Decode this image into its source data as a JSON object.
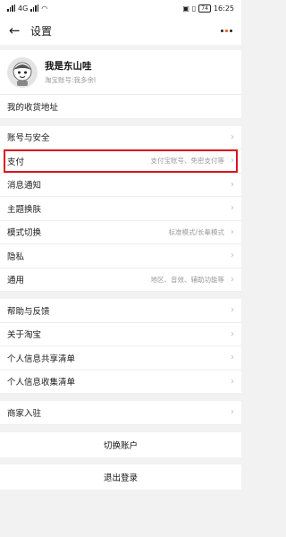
{
  "status_bar": {
    "signal": "4G",
    "time": "16:25",
    "battery": "74"
  },
  "header": {
    "title": "设置"
  },
  "profile": {
    "nickname": "我是东山哇",
    "account": "淘宝账号:我多余l"
  },
  "rows": {
    "address": {
      "label": "我的收货地址"
    },
    "account_security": {
      "label": "账号与安全"
    },
    "payment": {
      "label": "支付",
      "value": "支付宝账号、免密支付等"
    },
    "notifications": {
      "label": "消息通知"
    },
    "theme": {
      "label": "主题换肤"
    },
    "mode": {
      "label": "模式切换",
      "value": "标准模式/长辈模式"
    },
    "privacy": {
      "label": "隐私"
    },
    "general": {
      "label": "通用",
      "value": "地区、音效、辅助功能等"
    },
    "help": {
      "label": "帮助与反馈"
    },
    "about": {
      "label": "关于淘宝"
    },
    "info_share": {
      "label": "个人信息共享清单"
    },
    "info_collect": {
      "label": "个人信息收集清单"
    },
    "merchant": {
      "label": "商家入驻"
    }
  },
  "actions": {
    "switch_account": "切换账户",
    "logout": "退出登录"
  },
  "colors": {
    "highlight": "#e0141e",
    "accent": "#ff5000"
  }
}
